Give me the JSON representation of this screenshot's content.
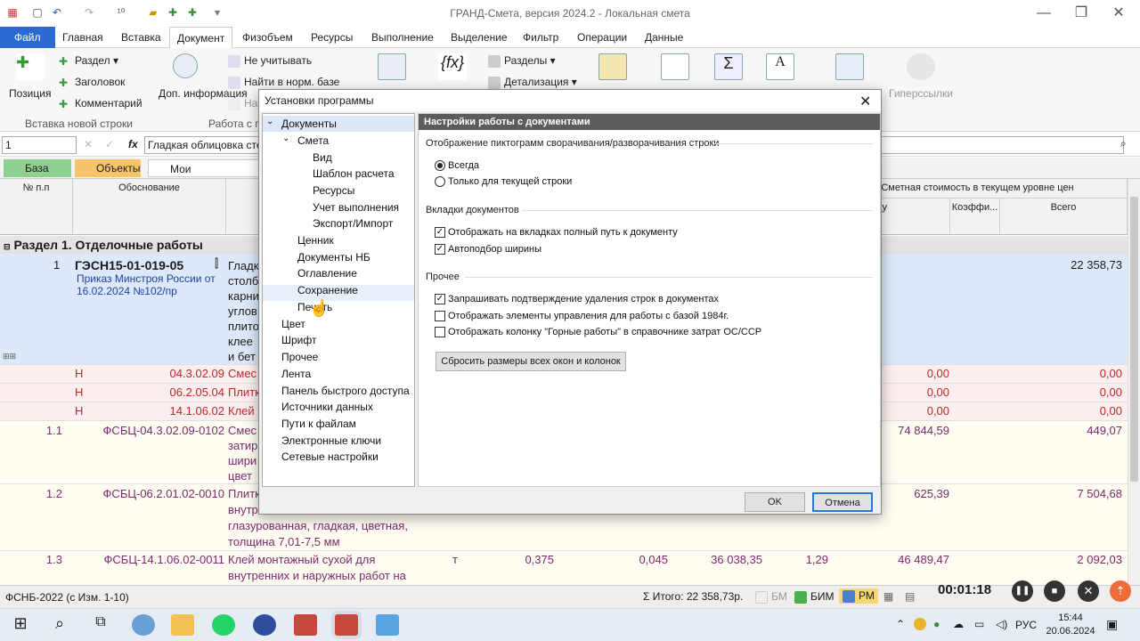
{
  "app": {
    "title": "ГРАНД-Смета, версия 2024.2 - Локальная смета"
  },
  "menu": {
    "file": "Файл",
    "items": [
      "Главная",
      "Вставка",
      "Документ",
      "Физобъем",
      "Ресурсы",
      "Выполнение",
      "Выделение",
      "Фильтр",
      "Операции",
      "Данные"
    ]
  },
  "ribbon": {
    "position": "Позиция",
    "section": "Раздел",
    "header": "Заголовок",
    "comment": "Комментарий",
    "insert_group": "Вставка новой строки",
    "extra_info": "Доп. информация",
    "ignore": "Не учитывать",
    "find_base": "Найти в норм. базе",
    "na_prefix": "Наз",
    "work_group": "Работа с п",
    "sections": "Разделы",
    "detail": "Детализация",
    "hyperlinks": "Гиперссылки"
  },
  "formula": {
    "cell": "1",
    "fx": "fx",
    "text": "Гладкая облицовка сте"
  },
  "doc_tabs": {
    "base": "База",
    "objects": "Объекты",
    "path": "Мои сметы\\КТ\\Лока"
  },
  "grid": {
    "headers": {
      "num": "№ п.п",
      "basis": "Обоснование",
      "cost_title": "Сметная стоимость в текущем уровне цен",
      "unit": "единицу",
      "coef": "Коэффи...",
      "total": "Всего"
    },
    "section": "Раздел 1. Отделочные работы",
    "rows": [
      {
        "n": "1",
        "code": "ГЭСН15-01-019-05",
        "sub": "Приказ Минстроя России от 16.02.2024 №102/пр",
        "name": [
          "Гладк",
          "столб",
          "карни",
          "углов",
          "плито",
          "клее",
          "и бет"
        ],
        "total": "22 358,73"
      },
      {
        "n": "Н",
        "code": "04.3.02.09",
        "name": "Смес",
        "unit_price": "0,00",
        "total": "0,00"
      },
      {
        "n": "Н",
        "code": "06.2.05.04",
        "name": "Плитк",
        "unit_price": "0,00",
        "total": "0,00"
      },
      {
        "n": "Н",
        "code": "14.1.06.02",
        "name": "Клей",
        "unit_price": "0,00",
        "total": "0,00"
      },
      {
        "n": "1.1",
        "code": "ФСБЦ-04.3.02.09-0102",
        "name": [
          "Смес",
          "затир",
          "шири",
          "цвет"
        ],
        "unit_price": "74 844,59",
        "total": "449,07"
      },
      {
        "n": "1.2",
        "code": "ФСБЦ-06.2.01.02-0010",
        "name": [
          "Плитк",
          "внутр",
          "глазурованная, гладкая, цветная,",
          "толщина 7,01-7,5 мм"
        ],
        "unit_price": "625,39",
        "total": "7 504,68"
      },
      {
        "n": "1.3",
        "code": "ФСБЦ-14.1.06.02-0011",
        "name": [
          "Клей монтажный сухой для",
          "внутренних и наружных работ на"
        ],
        "unit": "т",
        "qty": "0,375",
        "c1": "0,045",
        "c2": "36 038,35",
        "c3": "1,29",
        "unit_price": "46 489,47",
        "total": "2 092,03"
      }
    ]
  },
  "status": {
    "norm": "ФСНБ-2022 (с Изм. 1-10)",
    "total": "Итого: 22 358,73р.",
    "bm": "БМ",
    "bim": "БИМ",
    "rm": "РМ"
  },
  "recorder": {
    "time": "00:01:18"
  },
  "taskbar": {
    "lang": "РУС",
    "time": "15:44",
    "date": "20.06.2024"
  },
  "dialog": {
    "title": "Установки программы",
    "tree": [
      {
        "label": "Документы",
        "level": 0,
        "expanded": true,
        "selected": true
      },
      {
        "label": "Смета",
        "level": 1,
        "expanded": true
      },
      {
        "label": "Вид",
        "level": 2
      },
      {
        "label": "Шаблон расчета",
        "level": 2
      },
      {
        "label": "Ресурсы",
        "level": 2
      },
      {
        "label": "Учет выполнения",
        "level": 2
      },
      {
        "label": "Экспорт/Импорт",
        "level": 2
      },
      {
        "label": "Ценник",
        "level": 1
      },
      {
        "label": "Документы НБ",
        "level": 1
      },
      {
        "label": "Оглавление",
        "level": 1
      },
      {
        "label": "Сохранение",
        "level": 1,
        "hover": true
      },
      {
        "label": "Печать",
        "level": 1
      },
      {
        "label": "Цвет",
        "level": 0
      },
      {
        "label": "Шрифт",
        "level": 0
      },
      {
        "label": "Прочее",
        "level": 0
      },
      {
        "label": "Лента",
        "level": 0
      },
      {
        "label": "Панель быстрого доступа",
        "level": 0
      },
      {
        "label": "Источники данных",
        "level": 0
      },
      {
        "label": "Пути к файлам",
        "level": 0
      },
      {
        "label": "Электронные ключи",
        "level": 0
      },
      {
        "label": "Сетевые настройки",
        "level": 0
      }
    ],
    "panel_title": "Настройки работы с документами",
    "s1": "Отображение пиктограмм сворачивания/разворачивания строки",
    "r_always": "Всегда",
    "r_current": "Только для текущей строки",
    "s2": "Вкладки документов",
    "c_fullpath": "Отображать  на вкладках  полный путь к документу",
    "c_autowidth": "Автоподбор ширины",
    "s3": "Прочее",
    "c_confirm": "Запрашивать подтверждение удаления строк в документах",
    "c_1984": "Отображать элементы управления для работы с базой 1984г.",
    "c_mining": "Отображать колонку \"Горные работы\" в справочнике затрат ОС/ССР",
    "reset": "Сбросить размеры всех окон и колонок",
    "ok": "OK",
    "cancel": "Отмена"
  }
}
